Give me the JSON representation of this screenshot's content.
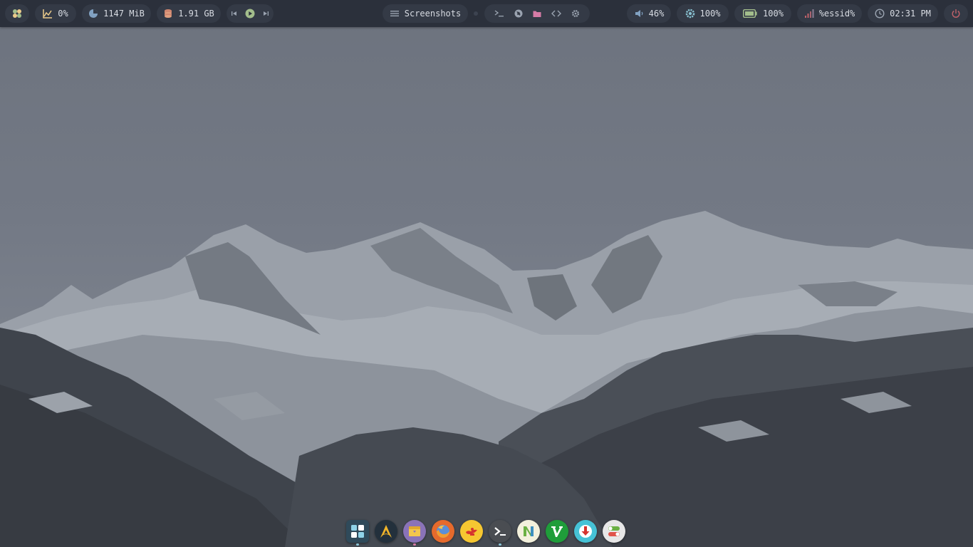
{
  "topbar": {
    "launcher": {
      "icon": "apps-flower-icon"
    },
    "cpu": {
      "icon": "cpu-chart-icon",
      "value": "0%"
    },
    "memory": {
      "icon": "memory-pie-icon",
      "value": "1147 MiB"
    },
    "disk": {
      "icon": "disk-stack-icon",
      "value": "1.91 GB"
    },
    "media": {
      "prev_icon": "skip-previous-icon",
      "play_icon": "play-icon",
      "next_icon": "skip-next-icon"
    },
    "window_title": {
      "icon": "hamburger-icon",
      "label": "Screenshots"
    },
    "quick_launch": [
      {
        "name": "terminal-icon"
      },
      {
        "name": "globe-icon"
      },
      {
        "name": "folder-icon"
      },
      {
        "name": "code-icon"
      },
      {
        "name": "gear-icon"
      }
    ],
    "volume": {
      "icon": "speaker-icon",
      "value": "46%"
    },
    "brightness": {
      "icon": "brightness-icon",
      "value": "100%"
    },
    "battery": {
      "icon": "battery-icon",
      "value": "100%"
    },
    "wifi": {
      "icon": "signal-bars-icon",
      "value": "%essid%"
    },
    "clock": {
      "icon": "clock-icon",
      "value": "02:31 PM"
    },
    "power": {
      "icon": "power-icon"
    }
  },
  "dock": {
    "apps": [
      {
        "name": "dock-app-launcher"
      },
      {
        "name": "dock-app-arch"
      },
      {
        "name": "dock-app-archive-manager"
      },
      {
        "name": "dock-app-firefox"
      },
      {
        "name": "dock-app-genie"
      },
      {
        "name": "dock-app-terminal"
      },
      {
        "name": "dock-app-nvim"
      },
      {
        "name": "dock-app-vim"
      },
      {
        "name": "dock-app-updater"
      },
      {
        "name": "dock-app-settings-toggle"
      }
    ]
  },
  "colors": {
    "bar_bg": "#2b303b",
    "pill_bg": "#343a46",
    "text": "#d8dce3",
    "accent_green": "#a3be8c",
    "accent_blue": "#81a1c1",
    "accent_pink": "#d67ba6",
    "accent_red": "#bf616a",
    "accent_yellow": "#ebcb8b"
  }
}
